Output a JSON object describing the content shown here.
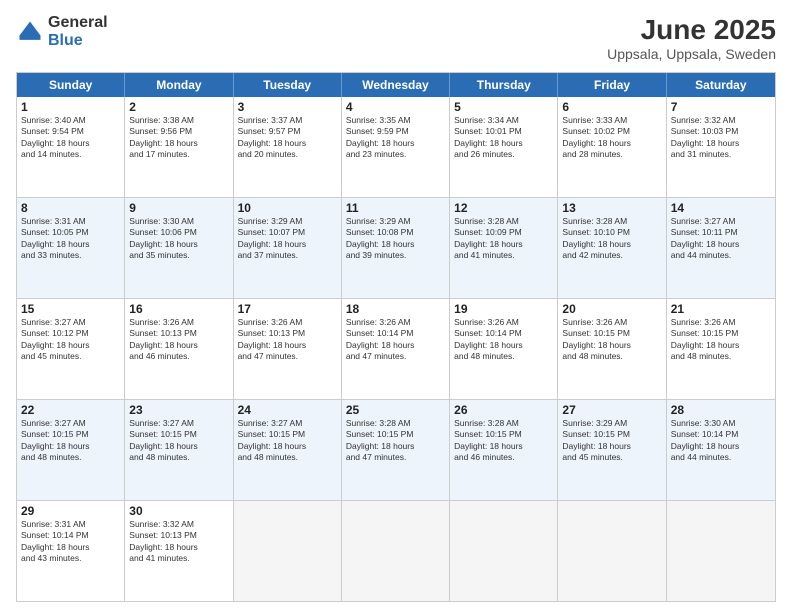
{
  "logo": {
    "general": "General",
    "blue": "Blue"
  },
  "title": "June 2025",
  "subtitle": "Uppsala, Uppsala, Sweden",
  "header_days": [
    "Sunday",
    "Monday",
    "Tuesday",
    "Wednesday",
    "Thursday",
    "Friday",
    "Saturday"
  ],
  "weeks": [
    [
      {
        "day": "1",
        "info": "Sunrise: 3:40 AM\nSunset: 9:54 PM\nDaylight: 18 hours\nand 14 minutes."
      },
      {
        "day": "2",
        "info": "Sunrise: 3:38 AM\nSunset: 9:56 PM\nDaylight: 18 hours\nand 17 minutes."
      },
      {
        "day": "3",
        "info": "Sunrise: 3:37 AM\nSunset: 9:57 PM\nDaylight: 18 hours\nand 20 minutes."
      },
      {
        "day": "4",
        "info": "Sunrise: 3:35 AM\nSunset: 9:59 PM\nDaylight: 18 hours\nand 23 minutes."
      },
      {
        "day": "5",
        "info": "Sunrise: 3:34 AM\nSunset: 10:01 PM\nDaylight: 18 hours\nand 26 minutes."
      },
      {
        "day": "6",
        "info": "Sunrise: 3:33 AM\nSunset: 10:02 PM\nDaylight: 18 hours\nand 28 minutes."
      },
      {
        "day": "7",
        "info": "Sunrise: 3:32 AM\nSunset: 10:03 PM\nDaylight: 18 hours\nand 31 minutes."
      }
    ],
    [
      {
        "day": "8",
        "info": "Sunrise: 3:31 AM\nSunset: 10:05 PM\nDaylight: 18 hours\nand 33 minutes."
      },
      {
        "day": "9",
        "info": "Sunrise: 3:30 AM\nSunset: 10:06 PM\nDaylight: 18 hours\nand 35 minutes."
      },
      {
        "day": "10",
        "info": "Sunrise: 3:29 AM\nSunset: 10:07 PM\nDaylight: 18 hours\nand 37 minutes."
      },
      {
        "day": "11",
        "info": "Sunrise: 3:29 AM\nSunset: 10:08 PM\nDaylight: 18 hours\nand 39 minutes."
      },
      {
        "day": "12",
        "info": "Sunrise: 3:28 AM\nSunset: 10:09 PM\nDaylight: 18 hours\nand 41 minutes."
      },
      {
        "day": "13",
        "info": "Sunrise: 3:28 AM\nSunset: 10:10 PM\nDaylight: 18 hours\nand 42 minutes."
      },
      {
        "day": "14",
        "info": "Sunrise: 3:27 AM\nSunset: 10:11 PM\nDaylight: 18 hours\nand 44 minutes."
      }
    ],
    [
      {
        "day": "15",
        "info": "Sunrise: 3:27 AM\nSunset: 10:12 PM\nDaylight: 18 hours\nand 45 minutes."
      },
      {
        "day": "16",
        "info": "Sunrise: 3:26 AM\nSunset: 10:13 PM\nDaylight: 18 hours\nand 46 minutes."
      },
      {
        "day": "17",
        "info": "Sunrise: 3:26 AM\nSunset: 10:13 PM\nDaylight: 18 hours\nand 47 minutes."
      },
      {
        "day": "18",
        "info": "Sunrise: 3:26 AM\nSunset: 10:14 PM\nDaylight: 18 hours\nand 47 minutes."
      },
      {
        "day": "19",
        "info": "Sunrise: 3:26 AM\nSunset: 10:14 PM\nDaylight: 18 hours\nand 48 minutes."
      },
      {
        "day": "20",
        "info": "Sunrise: 3:26 AM\nSunset: 10:15 PM\nDaylight: 18 hours\nand 48 minutes."
      },
      {
        "day": "21",
        "info": "Sunrise: 3:26 AM\nSunset: 10:15 PM\nDaylight: 18 hours\nand 48 minutes."
      }
    ],
    [
      {
        "day": "22",
        "info": "Sunrise: 3:27 AM\nSunset: 10:15 PM\nDaylight: 18 hours\nand 48 minutes."
      },
      {
        "day": "23",
        "info": "Sunrise: 3:27 AM\nSunset: 10:15 PM\nDaylight: 18 hours\nand 48 minutes."
      },
      {
        "day": "24",
        "info": "Sunrise: 3:27 AM\nSunset: 10:15 PM\nDaylight: 18 hours\nand 48 minutes."
      },
      {
        "day": "25",
        "info": "Sunrise: 3:28 AM\nSunset: 10:15 PM\nDaylight: 18 hours\nand 47 minutes."
      },
      {
        "day": "26",
        "info": "Sunrise: 3:28 AM\nSunset: 10:15 PM\nDaylight: 18 hours\nand 46 minutes."
      },
      {
        "day": "27",
        "info": "Sunrise: 3:29 AM\nSunset: 10:15 PM\nDaylight: 18 hours\nand 45 minutes."
      },
      {
        "day": "28",
        "info": "Sunrise: 3:30 AM\nSunset: 10:14 PM\nDaylight: 18 hours\nand 44 minutes."
      }
    ],
    [
      {
        "day": "29",
        "info": "Sunrise: 3:31 AM\nSunset: 10:14 PM\nDaylight: 18 hours\nand 43 minutes."
      },
      {
        "day": "30",
        "info": "Sunrise: 3:32 AM\nSunset: 10:13 PM\nDaylight: 18 hours\nand 41 minutes."
      },
      null,
      null,
      null,
      null,
      null
    ]
  ]
}
